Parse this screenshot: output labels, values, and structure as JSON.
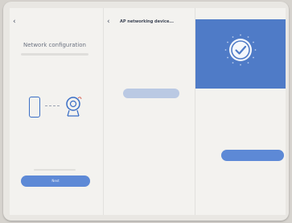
{
  "status_bar": {
    "time": "",
    "right": ""
  },
  "panel1": {
    "back_icon": "chevron-left-icon",
    "nav_title": "",
    "heading": "Network configuration",
    "button_label": "Next"
  },
  "panel2": {
    "back_icon": "chevron-left-icon",
    "nav_title": "AP networking device...",
    "button_label": ""
  },
  "panel3": {
    "hero_title": "",
    "hero_caption": "",
    "info_title": "",
    "info_sub": "",
    "rows": [
      {
        "key": "",
        "value": ""
      },
      {
        "key": "",
        "value": ""
      },
      {
        "key": "",
        "value": ""
      }
    ],
    "button_label": ""
  },
  "colors": {
    "accent": "#5d89d6",
    "hero": "#4f7bc7",
    "disabled_button": "#bac9e3"
  }
}
